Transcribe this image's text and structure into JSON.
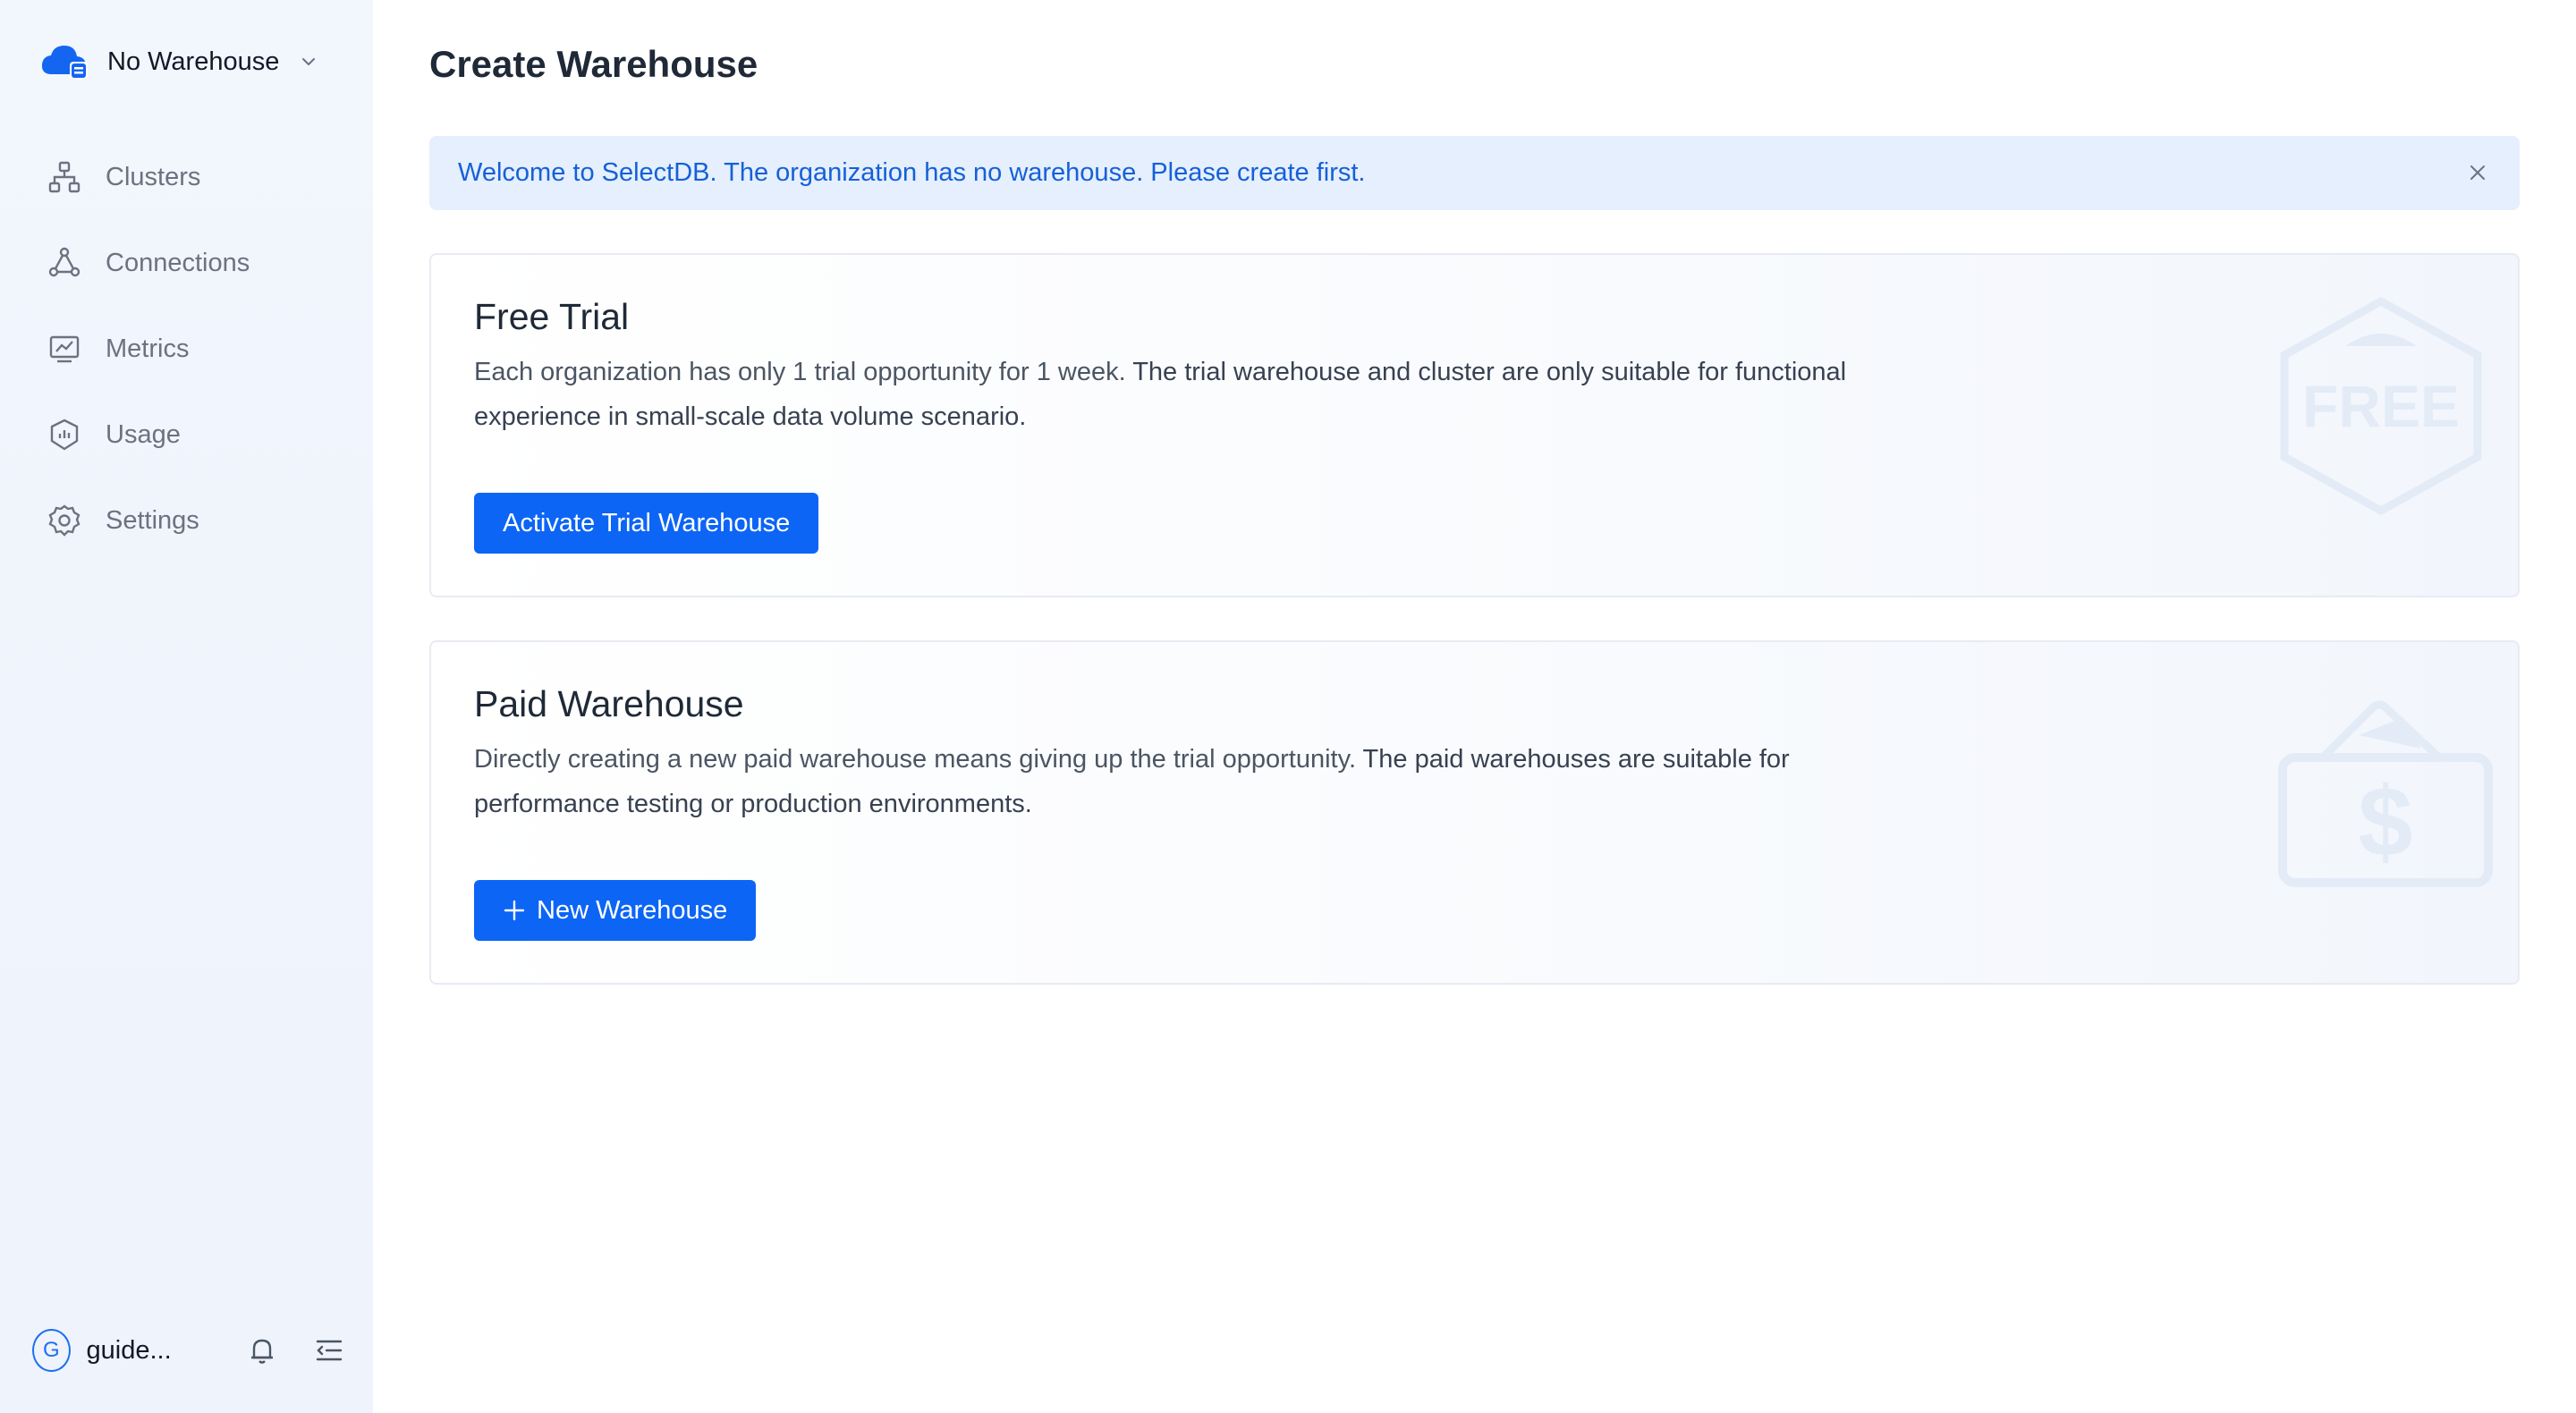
{
  "sidebar": {
    "warehouse_switcher": {
      "label": "No Warehouse"
    },
    "nav": [
      {
        "label": "Clusters",
        "icon": "cluster-icon"
      },
      {
        "label": "Connections",
        "icon": "connections-icon"
      },
      {
        "label": "Metrics",
        "icon": "metrics-chart-icon"
      },
      {
        "label": "Usage",
        "icon": "usage-shield-icon"
      },
      {
        "label": "Settings",
        "icon": "gear-icon"
      }
    ],
    "footer": {
      "avatar_initial": "G",
      "user_name": "guide..."
    }
  },
  "main": {
    "title": "Create Warehouse",
    "alert": {
      "text": "Welcome to SelectDB. The organization has no warehouse. Please create first."
    },
    "trial_card": {
      "title": "Free Trial",
      "desc_plain": "Each organization has only 1 trial opportunity for 1 week. ",
      "desc_bold": "The trial warehouse and cluster are only suitable for functional experience in small-scale data volume scenario.",
      "button_label": "Activate Trial Warehouse",
      "badge_text": "FREE"
    },
    "paid_card": {
      "title": "Paid Warehouse",
      "desc_plain": "Directly creating a new paid warehouse means giving up the trial opportunity. ",
      "desc_bold": "The paid warehouses are suitable for performance testing or production environments.",
      "button_label": "New Warehouse",
      "badge_text": "$"
    }
  },
  "colors": {
    "primary": "#0c65f5",
    "alert_bg": "#e5effd",
    "alert_text": "#1560d8",
    "sidebar_bg": "#f2f6fd"
  }
}
